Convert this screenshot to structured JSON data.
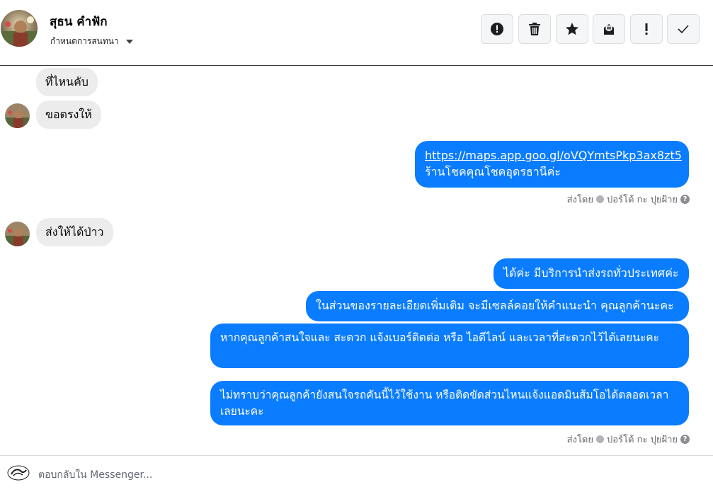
{
  "header": {
    "contact_name": "สุธน คำฟัก",
    "conversation_settings": "กำหนดการสนทนา"
  },
  "toolbar": {
    "buttons": [
      {
        "icon": "alert-circle-icon"
      },
      {
        "icon": "trash-icon"
      },
      {
        "icon": "star-icon"
      },
      {
        "icon": "mail-icon"
      },
      {
        "icon": "exclamation-icon"
      },
      {
        "icon": "check-icon"
      }
    ]
  },
  "messages": [
    {
      "direction": "in",
      "text": "ที่ไหนคับ"
    },
    {
      "direction": "in",
      "text": "ขอตรงให้"
    },
    {
      "direction": "out",
      "link": "https://maps.app.goo.gl/oVQYmtsPkp3ax8zt5",
      "text": "ร้านโชคคุณโชคอุดรธานีค่ะ"
    },
    {
      "direction": "in",
      "text": "ส่งให้ได้ป่าว"
    },
    {
      "direction": "out",
      "text": "ได้ค่ะ มีบริการนำส่งรถทั่วประเทศค่ะ"
    },
    {
      "direction": "out",
      "text": "ในส่วนของรายละเอียดเพิ่มเติม จะมีเซลล์คอยให้คำแนะนำ คุณลูกค้านะคะ"
    },
    {
      "direction": "out",
      "text": "หากคุณลูกค้าสนใจและ สะดวก แจ้งเบอร์ติดต่อ หรือ ไอดีไลน์ และเวลาที่สะดวกไว้ได้เลยนะคะ"
    },
    {
      "direction": "out",
      "text": "ไม่ทราบว่าคุณลูกค้ายังสนใจรถคันนี้ไว้ใช้งาน หรือติดขัดส่วนไหนแจ้งแอดมินส้มโอได้ตลอดเวลาเลยนะคะ"
    }
  ],
  "sent_by": {
    "prefix": "ส่งโดย",
    "name": "ปอร์โต้ กะ ปุยฝ้าย",
    "help_symbol": "?"
  },
  "composer": {
    "placeholder": "ตอบกลับใน Messenger..."
  },
  "colors": {
    "outgoing_bubble": "#0a7cff",
    "incoming_bubble": "#ececec"
  }
}
